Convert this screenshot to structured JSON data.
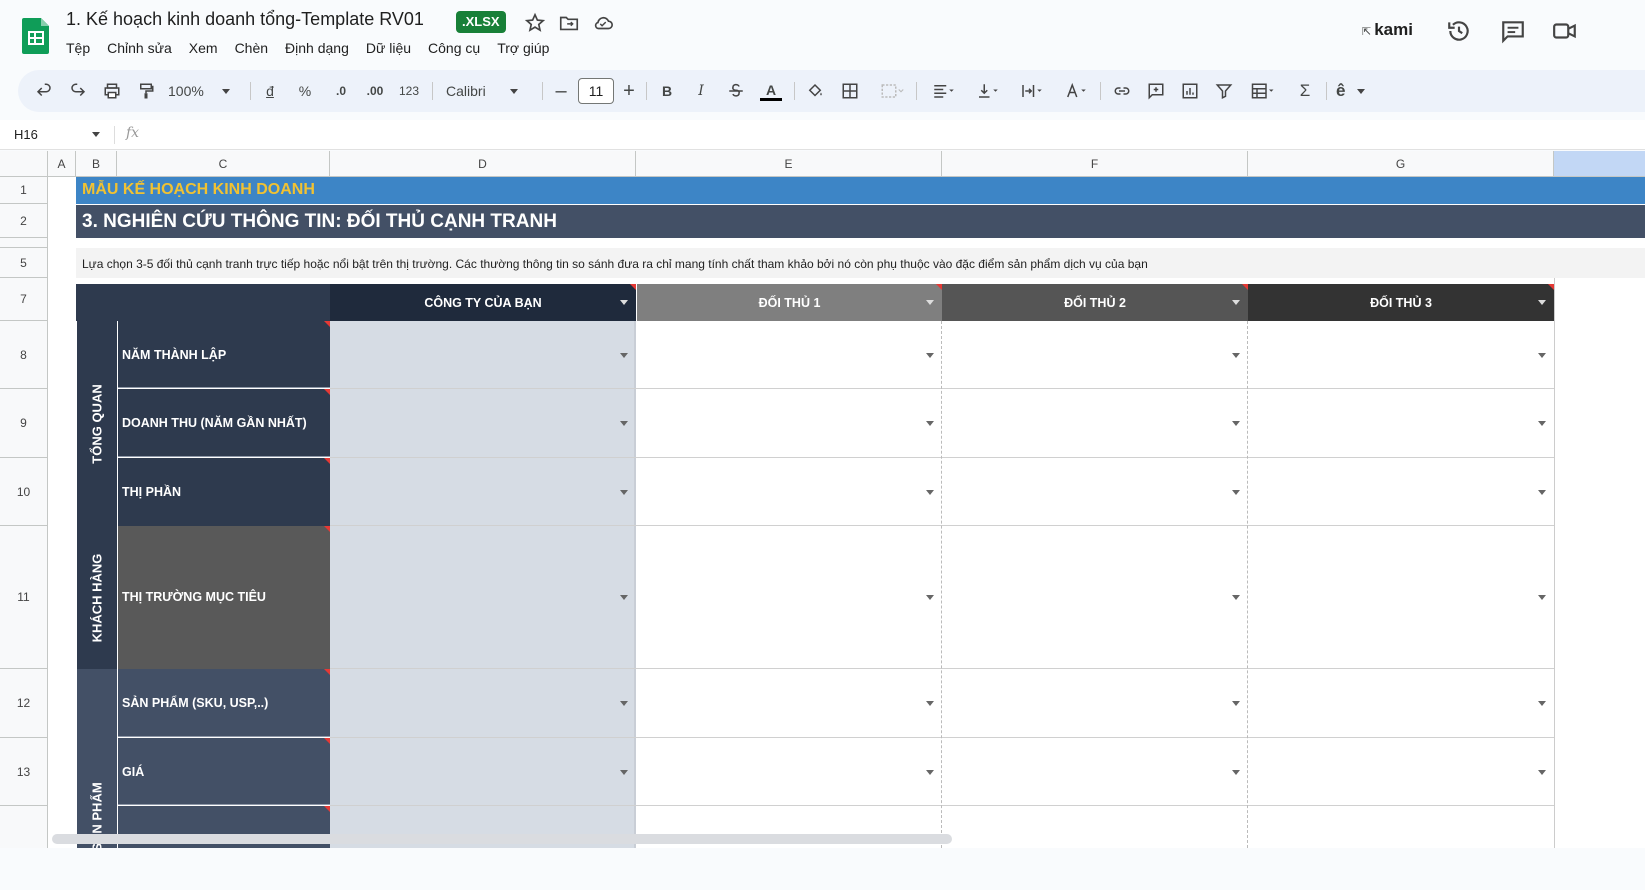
{
  "app": {
    "doc_title": "1. Kế hoạch kinh doanh tổng-Template RV01",
    "file_badge": ".XLSX",
    "menu": [
      "Tệp",
      "Chỉnh sửa",
      "Xem",
      "Chèn",
      "Định dạng",
      "Dữ liệu",
      "Công cụ",
      "Trợ giúp"
    ],
    "kami_label": "kami"
  },
  "toolbar": {
    "zoom": "100%",
    "currency": "đ",
    "percent": "%",
    "dec_decrease": ".0",
    "dec_increase": ".00",
    "number_format": "123",
    "font_name": "Calibri",
    "font_size": "11",
    "bold": "B",
    "italic": "I",
    "text_color_glyph": "A",
    "sigma": "Σ",
    "input_tool": "ê"
  },
  "formula_bar": {
    "cell_ref": "H16",
    "fx": "fx"
  },
  "columns": [
    "A",
    "B",
    "C",
    "D",
    "E",
    "F",
    "G"
  ],
  "rows": [
    "1",
    "2",
    "",
    "5",
    "7",
    "8",
    "9",
    "10",
    "11",
    "12",
    "13",
    ""
  ],
  "sheet": {
    "row1": "MẪU KẾ HOẠCH KINH DOANH",
    "row2": "3. NGHIÊN CỨU THÔNG TIN: ĐỐI THỦ CẠNH TRANH",
    "row5": "Lựa chọn 3-5 đối thủ cạnh tranh trực tiếp hoặc nổi bật trên thị trường. Các thường thông tin so sánh đưa ra chỉ mang tính chất tham khảo bởi nó còn phụ thuộc vào đặc điểm sản phẩm dịch vụ của bạn",
    "headers": [
      "CÔNG TY CỦA BẠN",
      "ĐỐI THỦ 1",
      "ĐỐI THỦ 2",
      "ĐỐI THỦ 3"
    ],
    "groups": [
      "TỔNG QUAN",
      "KHÁCH HÀNG",
      "SẢN PHẨM"
    ],
    "labels": [
      "NĂM THÀNH LẬP",
      "DOANH THU (NĂM GẦN NHẤT)",
      "THỊ PHẦN",
      "THỊ TRƯỜNG MỤC TIÊU",
      "SẢN PHẨM (SKU, USP,..)",
      "GIÁ"
    ]
  },
  "colors": {
    "title_bar": "#3d85c6",
    "title_text": "#f1c232",
    "section_bar": "#435066",
    "dark_navy": "#2e3a4e",
    "your_company_header": "#1f2a3c",
    "competitor1_header": "#7f7f7f",
    "competitor2_header": "#555555",
    "competitor3_header": "#333333",
    "your_company_cells": "#d6dce4"
  }
}
